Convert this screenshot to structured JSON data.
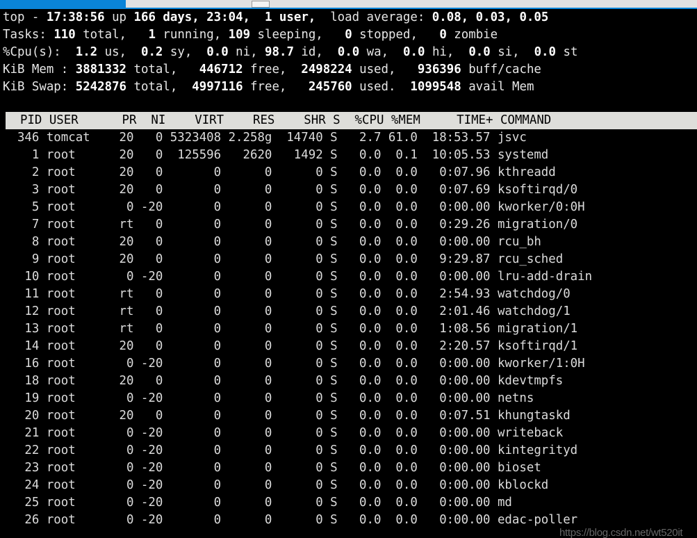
{
  "window": {
    "scrollbar": {
      "label": "horizontal-scrollbar"
    }
  },
  "summary": {
    "line1": {
      "program": "top",
      "dash": " - ",
      "time": "17:38:56",
      "uptime_label": " up ",
      "uptime": "166 days, 23:04,",
      "users": "  1 user,",
      "load_label": "  load average: ",
      "load1": "0.08,",
      "load5": " 0.03,",
      "load15": " 0.05",
      "raw": "top - 17:38:56 up 166 days, 23:04,  1 user,  load average: 0.08, 0.03, 0.05"
    },
    "tasks": {
      "label": "Tasks:",
      "total": "110",
      "total_label": " total,",
      "running": "1",
      "running_label": " running,",
      "sleeping": "109",
      "sleeping_label": " sleeping,",
      "stopped": "0",
      "stopped_label": " stopped,",
      "zombie": "0",
      "zombie_label": " zombie",
      "raw": "Tasks: 110 total,   1 running, 109 sleeping,   0 stopped,   0 zombie"
    },
    "cpu": {
      "label": "%Cpu(s):",
      "us": "1.2",
      "us_label": " us,",
      "sy": "0.2",
      "sy_label": " sy,",
      "ni": "0.0",
      "ni_label": " ni,",
      "id": "98.7",
      "id_label": " id,",
      "wa": "0.0",
      "wa_label": " wa,",
      "hi": "0.0",
      "hi_label": " hi,",
      "si": "0.0",
      "si_label": " si,",
      "st": "0.0",
      "st_label": " st",
      "raw": "%Cpu(s):  1.2 us,  0.2 sy,  0.0 ni, 98.7 id,  0.0 wa,  0.0 hi,  0.0 si,  0.0 st"
    },
    "mem": {
      "label": "KiB Mem :",
      "total": "3881332",
      "total_label": " total,",
      "free": "446712",
      "free_label": " free,",
      "used": "2498224",
      "used_label": " used,",
      "buff": "936396",
      "buff_label": " buff/cache",
      "raw": "KiB Mem : 3881332 total,   446712 free,  2498224 used,   936396 buff/cache"
    },
    "swap": {
      "label": "KiB Swap:",
      "total": "5242876",
      "total_label": " total,",
      "free": "4997116",
      "free_label": " free,",
      "used": "245760",
      "used_label": " used.",
      "avail": "1099548",
      "avail_label": " avail Mem",
      "raw": "KiB Swap: 5242876 total,  4997116 free,   245760 used.  1099548 avail Mem"
    }
  },
  "table": {
    "header": {
      "pid": "PID",
      "user": "USER",
      "pr": "PR",
      "ni": "NI",
      "virt": "VIRT",
      "res": "RES",
      "shr": "SHR",
      "s": "S",
      "cpu": "%CPU",
      "mem": "%MEM",
      "time": "TIME+",
      "command": "COMMAND",
      "raw": "  PID USER      PR  NI    VIRT    RES    SHR S  %CPU %MEM     TIME+ COMMAND"
    },
    "rows": [
      {
        "pid": "346",
        "user": "tomcat",
        "pr": "20",
        "ni": "0",
        "virt": "5323408",
        "res": "2.258g",
        "shr": "14740",
        "s": "S",
        "cpu": "2.7",
        "mem": "61.0",
        "time": "18:53.57",
        "command": "jsvc",
        "raw": "  346 tomcat    20   0 5323408 2.258g  14740 S   2.7 61.0  18:53.57 jsvc"
      },
      {
        "pid": "1",
        "user": "root",
        "pr": "20",
        "ni": "0",
        "virt": "125596",
        "res": "2620",
        "shr": "1492",
        "s": "S",
        "cpu": "0.0",
        "mem": "0.1",
        "time": "10:05.53",
        "command": "systemd",
        "raw": "    1 root      20   0  125596   2620   1492 S   0.0  0.1  10:05.53 systemd"
      },
      {
        "pid": "2",
        "user": "root",
        "pr": "20",
        "ni": "0",
        "virt": "0",
        "res": "0",
        "shr": "0",
        "s": "S",
        "cpu": "0.0",
        "mem": "0.0",
        "time": "0:07.96",
        "command": "kthreadd",
        "raw": "    2 root      20   0       0      0      0 S   0.0  0.0   0:07.96 kthreadd"
      },
      {
        "pid": "3",
        "user": "root",
        "pr": "20",
        "ni": "0",
        "virt": "0",
        "res": "0",
        "shr": "0",
        "s": "S",
        "cpu": "0.0",
        "mem": "0.0",
        "time": "0:07.69",
        "command": "ksoftirqd/0",
        "raw": "    3 root      20   0       0      0      0 S   0.0  0.0   0:07.69 ksoftirqd/0"
      },
      {
        "pid": "5",
        "user": "root",
        "pr": "0",
        "ni": "-20",
        "virt": "0",
        "res": "0",
        "shr": "0",
        "s": "S",
        "cpu": "0.0",
        "mem": "0.0",
        "time": "0:00.00",
        "command": "kworker/0:0H",
        "raw": "    5 root       0 -20       0      0      0 S   0.0  0.0   0:00.00 kworker/0:0H"
      },
      {
        "pid": "7",
        "user": "root",
        "pr": "rt",
        "ni": "0",
        "virt": "0",
        "res": "0",
        "shr": "0",
        "s": "S",
        "cpu": "0.0",
        "mem": "0.0",
        "time": "0:29.26",
        "command": "migration/0",
        "raw": "    7 root      rt   0       0      0      0 S   0.0  0.0   0:29.26 migration/0"
      },
      {
        "pid": "8",
        "user": "root",
        "pr": "20",
        "ni": "0",
        "virt": "0",
        "res": "0",
        "shr": "0",
        "s": "S",
        "cpu": "0.0",
        "mem": "0.0",
        "time": "0:00.00",
        "command": "rcu_bh",
        "raw": "    8 root      20   0       0      0      0 S   0.0  0.0   0:00.00 rcu_bh"
      },
      {
        "pid": "9",
        "user": "root",
        "pr": "20",
        "ni": "0",
        "virt": "0",
        "res": "0",
        "shr": "0",
        "s": "S",
        "cpu": "0.0",
        "mem": "0.0",
        "time": "9:29.87",
        "command": "rcu_sched",
        "raw": "    9 root      20   0       0      0      0 S   0.0  0.0   9:29.87 rcu_sched"
      },
      {
        "pid": "10",
        "user": "root",
        "pr": "0",
        "ni": "-20",
        "virt": "0",
        "res": "0",
        "shr": "0",
        "s": "S",
        "cpu": "0.0",
        "mem": "0.0",
        "time": "0:00.00",
        "command": "lru-add-drain",
        "raw": "   10 root       0 -20       0      0      0 S   0.0  0.0   0:00.00 lru-add-drain"
      },
      {
        "pid": "11",
        "user": "root",
        "pr": "rt",
        "ni": "0",
        "virt": "0",
        "res": "0",
        "shr": "0",
        "s": "S",
        "cpu": "0.0",
        "mem": "0.0",
        "time": "2:54.93",
        "command": "watchdog/0",
        "raw": "   11 root      rt   0       0      0      0 S   0.0  0.0   2:54.93 watchdog/0"
      },
      {
        "pid": "12",
        "user": "root",
        "pr": "rt",
        "ni": "0",
        "virt": "0",
        "res": "0",
        "shr": "0",
        "s": "S",
        "cpu": "0.0",
        "mem": "0.0",
        "time": "2:01.46",
        "command": "watchdog/1",
        "raw": "   12 root      rt   0       0      0      0 S   0.0  0.0   2:01.46 watchdog/1"
      },
      {
        "pid": "13",
        "user": "root",
        "pr": "rt",
        "ni": "0",
        "virt": "0",
        "res": "0",
        "shr": "0",
        "s": "S",
        "cpu": "0.0",
        "mem": "0.0",
        "time": "1:08.56",
        "command": "migration/1",
        "raw": "   13 root      rt   0       0      0      0 S   0.0  0.0   1:08.56 migration/1"
      },
      {
        "pid": "14",
        "user": "root",
        "pr": "20",
        "ni": "0",
        "virt": "0",
        "res": "0",
        "shr": "0",
        "s": "S",
        "cpu": "0.0",
        "mem": "0.0",
        "time": "2:20.57",
        "command": "ksoftirqd/1",
        "raw": "   14 root      20   0       0      0      0 S   0.0  0.0   2:20.57 ksoftirqd/1"
      },
      {
        "pid": "16",
        "user": "root",
        "pr": "0",
        "ni": "-20",
        "virt": "0",
        "res": "0",
        "shr": "0",
        "s": "S",
        "cpu": "0.0",
        "mem": "0.0",
        "time": "0:00.00",
        "command": "kworker/1:0H",
        "raw": "   16 root       0 -20       0      0      0 S   0.0  0.0   0:00.00 kworker/1:0H"
      },
      {
        "pid": "18",
        "user": "root",
        "pr": "20",
        "ni": "0",
        "virt": "0",
        "res": "0",
        "shr": "0",
        "s": "S",
        "cpu": "0.0",
        "mem": "0.0",
        "time": "0:00.00",
        "command": "kdevtmpfs",
        "raw": "   18 root      20   0       0      0      0 S   0.0  0.0   0:00.00 kdevtmpfs"
      },
      {
        "pid": "19",
        "user": "root",
        "pr": "0",
        "ni": "-20",
        "virt": "0",
        "res": "0",
        "shr": "0",
        "s": "S",
        "cpu": "0.0",
        "mem": "0.0",
        "time": "0:00.00",
        "command": "netns",
        "raw": "   19 root       0 -20       0      0      0 S   0.0  0.0   0:00.00 netns"
      },
      {
        "pid": "20",
        "user": "root",
        "pr": "20",
        "ni": "0",
        "virt": "0",
        "res": "0",
        "shr": "0",
        "s": "S",
        "cpu": "0.0",
        "mem": "0.0",
        "time": "0:07.51",
        "command": "khungtaskd",
        "raw": "   20 root      20   0       0      0      0 S   0.0  0.0   0:07.51 khungtaskd"
      },
      {
        "pid": "21",
        "user": "root",
        "pr": "0",
        "ni": "-20",
        "virt": "0",
        "res": "0",
        "shr": "0",
        "s": "S",
        "cpu": "0.0",
        "mem": "0.0",
        "time": "0:00.00",
        "command": "writeback",
        "raw": "   21 root       0 -20       0      0      0 S   0.0  0.0   0:00.00 writeback"
      },
      {
        "pid": "22",
        "user": "root",
        "pr": "0",
        "ni": "-20",
        "virt": "0",
        "res": "0",
        "shr": "0",
        "s": "S",
        "cpu": "0.0",
        "mem": "0.0",
        "time": "0:00.00",
        "command": "kintegrityd",
        "raw": "   22 root       0 -20       0      0      0 S   0.0  0.0   0:00.00 kintegrityd"
      },
      {
        "pid": "23",
        "user": "root",
        "pr": "0",
        "ni": "-20",
        "virt": "0",
        "res": "0",
        "shr": "0",
        "s": "S",
        "cpu": "0.0",
        "mem": "0.0",
        "time": "0:00.00",
        "command": "bioset",
        "raw": "   23 root       0 -20       0      0      0 S   0.0  0.0   0:00.00 bioset"
      },
      {
        "pid": "24",
        "user": "root",
        "pr": "0",
        "ni": "-20",
        "virt": "0",
        "res": "0",
        "shr": "0",
        "s": "S",
        "cpu": "0.0",
        "mem": "0.0",
        "time": "0:00.00",
        "command": "kblockd",
        "raw": "   24 root       0 -20       0      0      0 S   0.0  0.0   0:00.00 kblockd"
      },
      {
        "pid": "25",
        "user": "root",
        "pr": "0",
        "ni": "-20",
        "virt": "0",
        "res": "0",
        "shr": "0",
        "s": "S",
        "cpu": "0.0",
        "mem": "0.0",
        "time": "0:00.00",
        "command": "md",
        "raw": "   25 root       0 -20       0      0      0 S   0.0  0.0   0:00.00 md"
      },
      {
        "pid": "26",
        "user": "root",
        "pr": "0",
        "ni": "-20",
        "virt": "0",
        "res": "0",
        "shr": "0",
        "s": "S",
        "cpu": "0.0",
        "mem": "0.0",
        "time": "0:00.00",
        "command": "edac-poller",
        "raw": "   26 root       0 -20       0      0      0 S   0.0  0.0   0:00.00 edac-poller"
      }
    ]
  },
  "watermark": {
    "text": "https://blog.csdn.net/wt520it"
  },
  "colors": {
    "background": "#000000",
    "foreground": "#d8d8d8",
    "header_bg": "#dededa",
    "header_fg": "#000000",
    "accent_blue": "#0a84d8"
  }
}
